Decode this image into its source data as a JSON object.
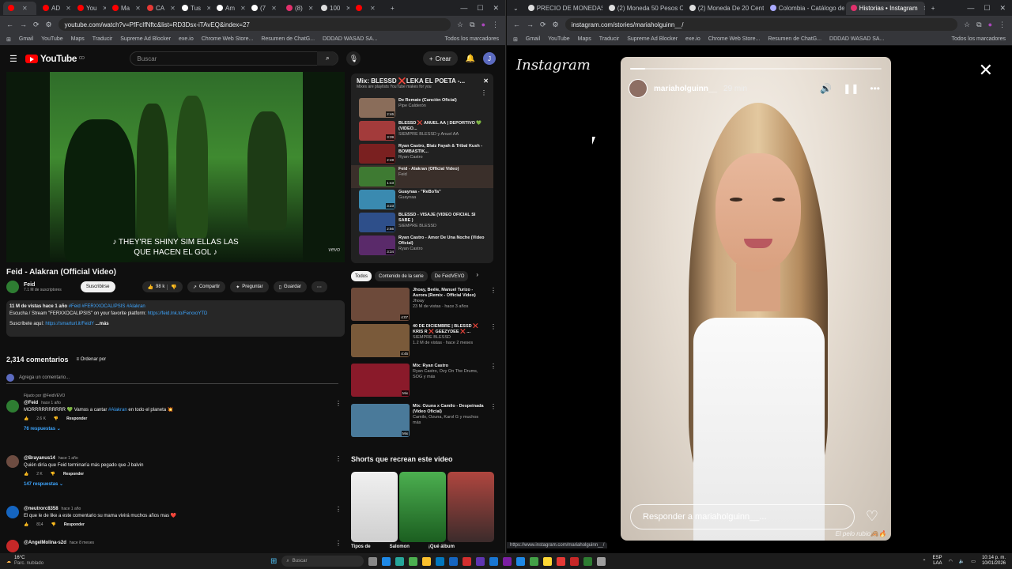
{
  "left_browser": {
    "tabs": [
      {
        "label": "",
        "color": "#ff0000"
      },
      {
        "label": "AD",
        "color": "#ff0000"
      },
      {
        "label": "You",
        "color": "#ff0000"
      },
      {
        "label": "Ma",
        "color": "#ff0000"
      },
      {
        "label": "CA",
        "color": "#e53935"
      },
      {
        "label": "Tus",
        "color": "#ffffff"
      },
      {
        "label": "Am",
        "color": "#ffffff"
      },
      {
        "label": "(7",
        "color": "#ffffff"
      },
      {
        "label": "(8)",
        "color": "#e1306c"
      },
      {
        "label": "100",
        "color": "#dddddd"
      },
      {
        "label": "",
        "color": "#ff0000"
      }
    ],
    "url": "youtube.com/watch?v=PfFcIfNftc&list=RD3Dsx-iTAvEQ&index=27",
    "bookmarks": [
      "Gmail",
      "YouTube",
      "Maps",
      "Traducir",
      "Supreme Ad Blocker",
      "exe.io",
      "Chrome Web Store...",
      "Resumen de ChatG...",
      "DDDAD WASAD SA..."
    ],
    "bookmarks_right": "Todos los marcadores"
  },
  "youtube": {
    "logo_text": "YouTube",
    "logo_country": "CO",
    "search_placeholder": "Buscar",
    "create_label": "Crear",
    "avatar_letter": "J",
    "subtitle_line1": "♪ THEY'RE SHINY SIM ELLAS LAS",
    "subtitle_line2": "QUE HACEN EL GOL ♪",
    "vevo": "vevo",
    "video_title": "Feid - Alakran (Official Video)",
    "channel_name": "Feid",
    "channel_subs": "7.1 M de suscriptores",
    "subscribe_label": "Suscribirse",
    "likes": "98 k",
    "share_label": "Compartir",
    "ask_label": "Preguntar",
    "save_label": "Guardar",
    "desc_stats": "11 M de vistas  hace 1 año",
    "desc_tags": "#Feid #FERXXOCALIPSIS #Alakran",
    "desc_line2": "Escucha / Stream \"FERXXOCALIPSIS\" on your favorite platform:",
    "desc_link2": "https://feid.lnk.to/FerxxoYTD",
    "desc_line3": "Suscríbete aquí:",
    "desc_link3": "https://smarturl.it/FeidY",
    "desc_more": "...más",
    "comments_count": "2,314 comentarios",
    "sort_label": "Ordenar por",
    "add_comment": "Agrega un comentario...",
    "comments": [
      {
        "pinned": "Fijado por @FeidVEVO",
        "author": "@Feid",
        "time": "hace 1 año",
        "text": "MORRRRRRRRRR 💚 Vamos a cantar",
        "tag": "#Alakran",
        "text2": "en todo el planeta 💥",
        "likes": "2.6 K",
        "reply": "Responder",
        "replies": "76 respuestas"
      },
      {
        "author": "@Brayanus14",
        "time": "hace 1 año",
        "text": "Quién diría que Feid terminaría más pegado que J balvin",
        "likes": "2 K",
        "reply": "Responder",
        "replies": "147 respuestas"
      },
      {
        "author": "@neutrorc8358",
        "time": "hace 1 año",
        "text": "El que le de like a este comentario su mama vivirá muchos años mas ❤️",
        "likes": "814",
        "reply": "Responder"
      },
      {
        "author": "@AngelMolina-s2d",
        "time": "hace 8 meses"
      }
    ],
    "mix_title": "Mix: BLESSD ❌LEKA EL POETA -...",
    "mix_sub": "Mixes are playlists YouTube makes for you",
    "mix_items": [
      {
        "title": "De Remate (Canción Oficial)",
        "artist": "Pipe Calderón",
        "duration": "2:46",
        "color": "#8a6d5a"
      },
      {
        "title": "BLESSD ❌ ANUEL AA | DEPORTIVO 💚 (VIDEO...",
        "artist": "SIEMPRE BLESSD y Anuel AA",
        "duration": "3:39",
        "color": "#a33b3b"
      },
      {
        "title": "Ryan Castro, Blaiz Fayah & Tribal Kush - BOMBASTIK...",
        "artist": "Ryan Castro",
        "duration": "2:48",
        "color": "#7a2020"
      },
      {
        "title": "Feid - Alakran (Official Video)",
        "artist": "Feid",
        "duration": "1:43",
        "color": "#3e7a32",
        "current": true
      },
      {
        "title": "Guaynaa - \"ReBoTa\"",
        "artist": "Guaynaa",
        "duration": "3:23",
        "color": "#3a8ab0"
      },
      {
        "title": "BLESSD - VISAJE (VIDEO OFICIAL SI SABE )",
        "artist": "SIEMPRE BLESSD",
        "duration": "2:56",
        "color": "#2e4f8a"
      },
      {
        "title": "Ryan Castro - Amor De Una Noche (Video Oficial)",
        "artist": "Ryan Castro",
        "duration": "3:34",
        "color": "#5a2a6a"
      }
    ],
    "chips": [
      "Todos",
      "Contenido de la serie",
      "De FeidVEVO"
    ],
    "recs": [
      {
        "title": "Jhoay, Beéle, Manuel Turizo - Aurora (Remix - Official Video)",
        "meta1": "Jhoay",
        "meta2": "23 M de vistas · hace 3 años",
        "duration": "4:07",
        "color": "#6d4a3a"
      },
      {
        "title": "40 DE DICIEMBRE | BLESSD ❌ KRIS R ❌ GEEZYDEE ❌ ...",
        "meta1": "SIEMPRE BLESSD",
        "meta2": "1.2 M de vistas · hace 2 meses",
        "duration": "4:45",
        "color": "#7a5a3a"
      },
      {
        "title": "Mix: Ryan Castro",
        "meta1": "Ryan Castro, Ovy On The Drums, SOG y más",
        "meta2": "",
        "duration": "Mix",
        "color": "#8a1a2a"
      },
      {
        "title": "Mix: Ozuna x Camilo - Despeinada (Video Oficial)",
        "meta1": "Camilo, Ozuna, Karol G y muchos más",
        "meta2": "",
        "duration": "Mix",
        "color": "#4a7a9a"
      }
    ],
    "shorts_title": "Shorts que recrean este video",
    "shorts_labels": [
      "Tipos de",
      "Salomon",
      "¡Qué álbum"
    ]
  },
  "right_browser": {
    "tabs": [
      {
        "label": "PRECIO DE MONEDAS -",
        "color": "#dddddd"
      },
      {
        "label": "(2) Moneda 50 Pesos Co",
        "color": "#dddddd"
      },
      {
        "label": "(2) Moneda De 20 Centa",
        "color": "#dddddd"
      },
      {
        "label": "Colombia - Catálogo de",
        "color": "#aaaaff"
      },
      {
        "label": "Historias • Instagram",
        "color": "#e1306c"
      }
    ],
    "url": "instagram.com/stories/mariaholguinn__/",
    "bookmarks": [
      "Gmail",
      "YouTube",
      "Maps",
      "Traducir",
      "Supreme Ad Blocker",
      "exe.io",
      "Chrome Web Store...",
      "Resumen de ChatG...",
      "DDDAD WASAD SA..."
    ],
    "bookmarks_right": "Todos los marcadores",
    "status_url": "https://www.instagram.com/mariaholguinn__/"
  },
  "instagram": {
    "logo": "Instagram",
    "username": "mariaholguinn__",
    "time_ago": "29 min",
    "progress_fraction": 0.06,
    "reply_placeholder": "Responder a mariaholguinn__...",
    "watermark": "El pelo rubio🙈🔥"
  },
  "taskbar": {
    "temp": "16°C",
    "weather": "Parc. nublado",
    "search": "Buscar",
    "lang1": "ESP",
    "lang2": "LAA",
    "time": "10:14 p. m.",
    "date": "10/01/2026"
  }
}
